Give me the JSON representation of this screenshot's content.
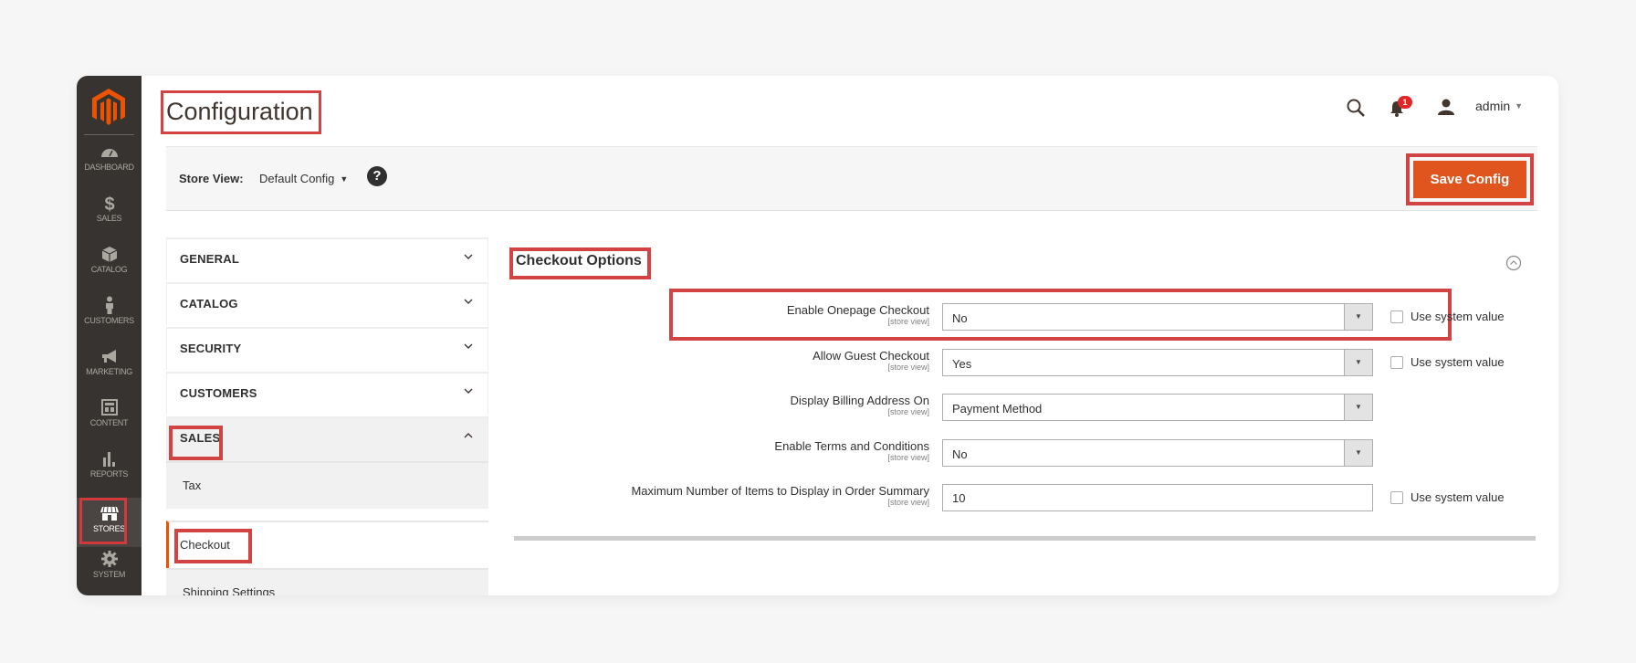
{
  "sidebar": {
    "items": [
      {
        "label": "Dashboard",
        "icon": "dashboard-icon"
      },
      {
        "label": "Sales",
        "icon": "dollar-icon"
      },
      {
        "label": "Catalog",
        "icon": "box-icon"
      },
      {
        "label": "Customers",
        "icon": "person-icon"
      },
      {
        "label": "Marketing",
        "icon": "megaphone-icon"
      },
      {
        "label": "Content",
        "icon": "layout-icon"
      },
      {
        "label": "Reports",
        "icon": "bar-chart-icon"
      },
      {
        "label": "Stores",
        "icon": "storefront-icon",
        "active": true
      },
      {
        "label": "System",
        "icon": "gear-icon"
      }
    ]
  },
  "header": {
    "title": "Configuration",
    "notification_count": "1",
    "user": "admin"
  },
  "store_view": {
    "label": "Store View:",
    "value": "Default Config",
    "help": "?"
  },
  "actions": {
    "save_label": "Save Config"
  },
  "config_nav": {
    "sections": [
      {
        "label": "GENERAL",
        "expanded": false
      },
      {
        "label": "CATALOG",
        "expanded": false
      },
      {
        "label": "SECURITY",
        "expanded": false
      },
      {
        "label": "CUSTOMERS",
        "expanded": false
      },
      {
        "label": "SALES",
        "expanded": true
      }
    ],
    "sales_items": [
      {
        "label": "Tax"
      },
      {
        "label": "Checkout",
        "active": true
      },
      {
        "label": "Shipping Settings"
      }
    ]
  },
  "checkout_options": {
    "title": "Checkout Options",
    "fields": [
      {
        "label": "Enable Onepage Checkout",
        "scope": "[store view]",
        "type": "select",
        "value": "No",
        "use_system_value": "Use system value"
      },
      {
        "label": "Allow Guest Checkout",
        "scope": "[store view]",
        "type": "select",
        "value": "Yes",
        "use_system_value": "Use system value"
      },
      {
        "label": "Display Billing Address On",
        "scope": "[store view]",
        "type": "select",
        "value": "Payment Method"
      },
      {
        "label": "Enable Terms and Conditions",
        "scope": "[store view]",
        "type": "select",
        "value": "No"
      },
      {
        "label": "Maximum Number of Items to Display in Order Summary",
        "scope": "[store view]",
        "type": "text",
        "value": "10",
        "use_system_value": "Use system value"
      }
    ]
  },
  "colors": {
    "brand_orange": "#eb5202",
    "save_button": "#e0541d",
    "highlight_red": "#d44343",
    "sidebar_bg": "#373330"
  }
}
